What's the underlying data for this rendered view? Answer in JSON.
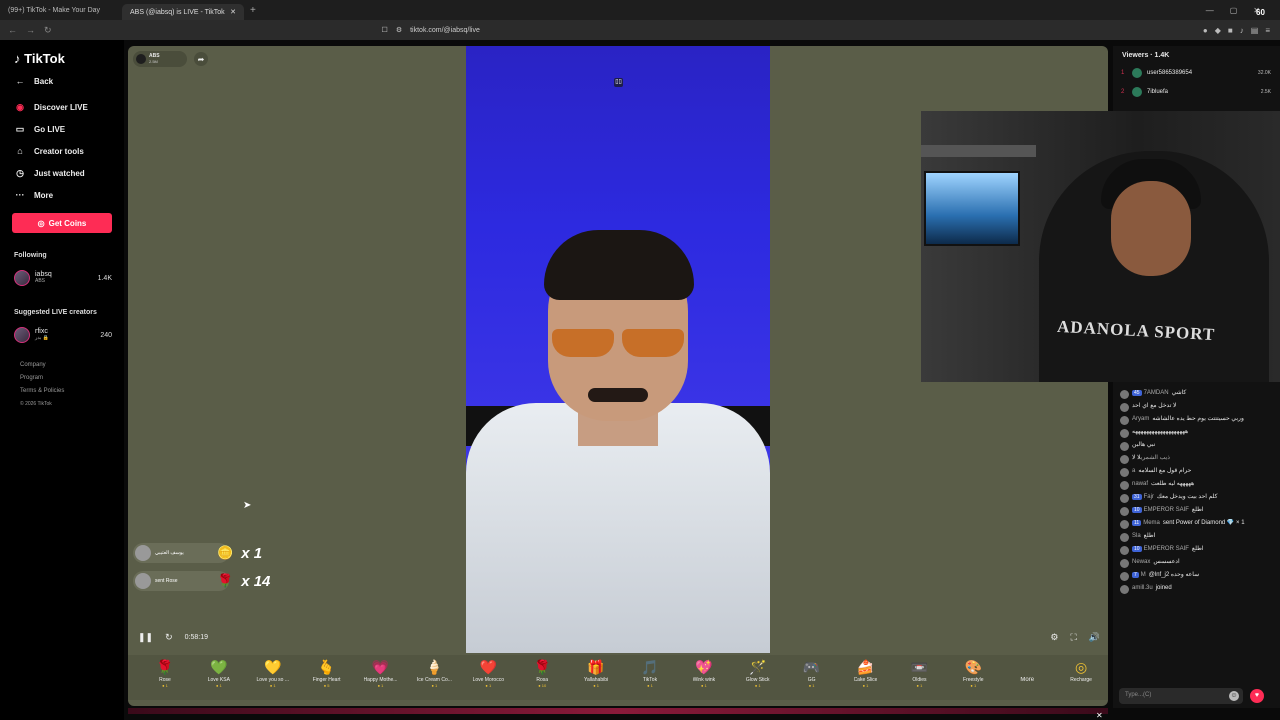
{
  "browser": {
    "tabs": [
      {
        "title": "(99+) TikTok - Make Your Day"
      },
      {
        "title": "ABS (@iabsq) is LIVE - TikTok"
      }
    ],
    "new_tab": "+",
    "url": "tiktok.com/@iabsq/live",
    "fps": "60"
  },
  "sidebar": {
    "logo": "TikTok",
    "back": "Back",
    "items": [
      {
        "label": "Discover LIVE",
        "icon": "live-icon"
      },
      {
        "label": "Go LIVE",
        "icon": "camera-icon"
      },
      {
        "label": "Creator tools",
        "icon": "home-icon"
      },
      {
        "label": "Just watched",
        "icon": "clock-icon"
      },
      {
        "label": "More",
        "icon": "dots-icon"
      }
    ],
    "get_coins": "Get Coins",
    "following_title": "Following",
    "following": [
      {
        "name": "iabsq",
        "sub": "ABS",
        "count": "1.4K"
      }
    ],
    "suggested_title": "Suggested LIVE creators",
    "suggested": [
      {
        "name": "rfixc",
        "sub": "بدر 🔒",
        "count": "240"
      }
    ],
    "footer": [
      "Company",
      "Program",
      "Terms & Policies",
      "© 2026 TikTok"
    ]
  },
  "stream": {
    "host_name": "ABS",
    "host_likes": "2.5M",
    "timer": "0:58:19",
    "gift_notifs": [
      {
        "user": "يوسف العتيبي",
        "text": "",
        "multiplier": "x 1"
      },
      {
        "user": "",
        "text": "sent Rose",
        "multiplier": "x 14"
      }
    ]
  },
  "gifts": [
    {
      "name": "Rose",
      "price": "1",
      "icon": "🌹"
    },
    {
      "name": "Love KSA",
      "price": "1",
      "icon": "💚"
    },
    {
      "name": "Love you so ...",
      "price": "1",
      "icon": "💛"
    },
    {
      "name": "Finger Heart",
      "price": "5",
      "icon": "🫰"
    },
    {
      "name": "Happy Mothe...",
      "price": "1",
      "icon": "💗"
    },
    {
      "name": "Ice Cream Co...",
      "price": "1",
      "icon": "🍦"
    },
    {
      "name": "Love Morocco",
      "price": "1",
      "icon": "❤️"
    },
    {
      "name": "Rosa",
      "price": "10",
      "icon": "🌹"
    },
    {
      "name": "Yallahabibi",
      "price": "1",
      "icon": "🎁"
    },
    {
      "name": "TikTok",
      "price": "1",
      "icon": "🎵"
    },
    {
      "name": "Wink wink",
      "price": "1",
      "icon": "💖"
    },
    {
      "name": "Glow Stick",
      "price": "1",
      "icon": "🪄"
    },
    {
      "name": "GG",
      "price": "1",
      "icon": "🎮"
    },
    {
      "name": "Cake Slice",
      "price": "1",
      "icon": "🍰"
    },
    {
      "name": "Oldies",
      "price": "1",
      "icon": "📼"
    },
    {
      "name": "Freestyle",
      "price": "1",
      "icon": "🎨"
    }
  ],
  "gift_more": "More",
  "recharge": "Recharge",
  "viewers": {
    "title": "Viewers · 1.4K",
    "list": [
      {
        "rank": "1",
        "name": "user5865389654",
        "amount": "32.0K"
      },
      {
        "rank": "2",
        "name": "7ibluefa",
        "amount": "2.5K"
      }
    ]
  },
  "webcam": {
    "shirt_text": "ADANOLA SPORT"
  },
  "chat": [
    {
      "badge": "45",
      "user": "7AMDAN",
      "text": "كاشي"
    },
    {
      "badge": "",
      "user": "",
      "text": "لا تدخل مع اي احد"
    },
    {
      "badge": "",
      "user": "Aryam",
      "text": "وربي حسيتتتت يوم حط يده عالشاشه"
    },
    {
      "badge": "",
      "user": "",
      "text": "هههههههههههههههههههه"
    },
    {
      "badge": "",
      "user": "",
      "text": "نبي هالبن"
    },
    {
      "badge": "",
      "user": "ذيب الشمري",
      "text": "لا لا"
    },
    {
      "badge": "",
      "user": "a",
      "text": "حرام قول مع السلامه"
    },
    {
      "badge": "",
      "user": "nawaf",
      "text": "هههههه ليه طلعت"
    },
    {
      "badge": "31",
      "user": "Fajr",
      "text": "كلم احد بيت ويدخل معك"
    },
    {
      "badge": "10",
      "user": "EMPEROR SAIF",
      "text": "اطلع"
    },
    {
      "badge": "11",
      "user": "Mema",
      "text": "sent Power of Diamond 💎 × 1"
    },
    {
      "badge": "",
      "user": "Sla",
      "text": "اطلع"
    },
    {
      "badge": "10",
      "user": "EMPEROR SAIF",
      "text": "اطلع"
    },
    {
      "badge": "",
      "user": "Newax",
      "text": "ادعسسس"
    },
    {
      "badge": "7",
      "user": "M",
      "text": "@lnf_j2 ساعه وحده"
    },
    {
      "badge": "",
      "user": "amill.3u",
      "text": "joined"
    }
  ],
  "chat_placeholder": "Type...(C)"
}
